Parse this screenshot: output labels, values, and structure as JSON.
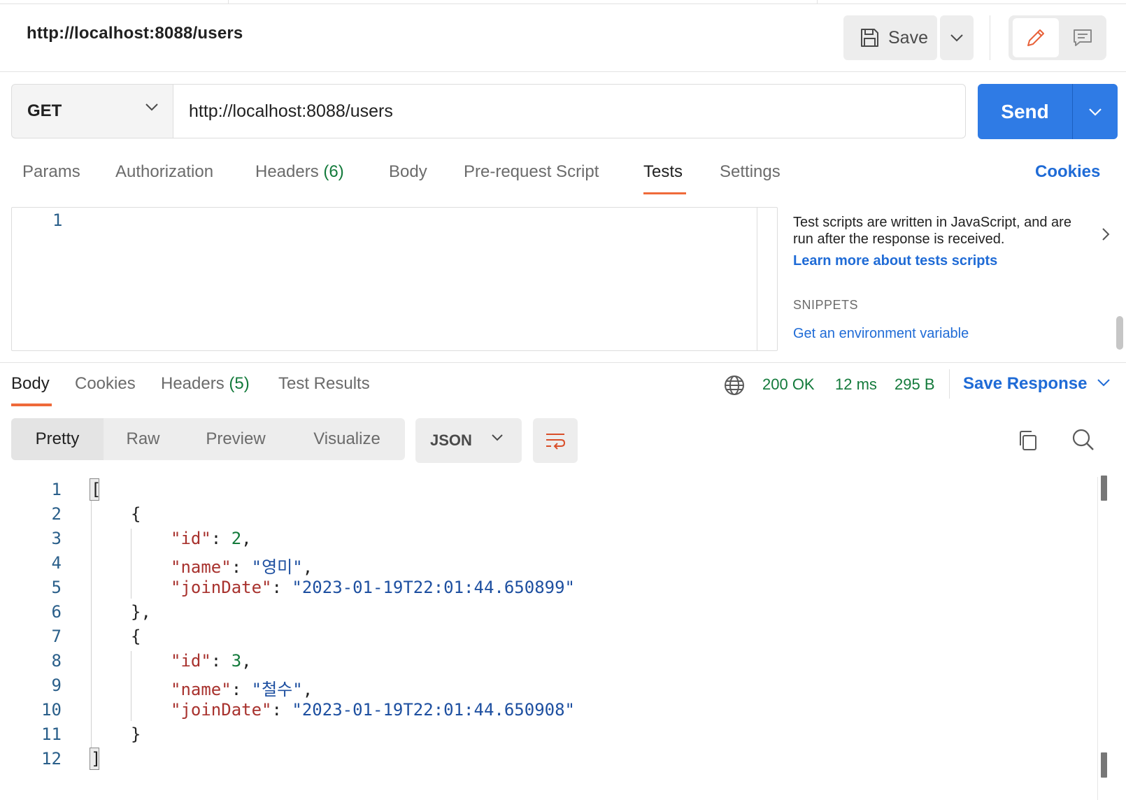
{
  "header": {
    "request_title": "http://localhost:8088/users",
    "save_label": "Save",
    "save_icon": "floppy-disk-icon",
    "edit_icon": "pencil-icon",
    "comment_icon": "comment-icon"
  },
  "request": {
    "method": "GET",
    "url": "http://localhost:8088/users",
    "send_label": "Send"
  },
  "request_tabs": {
    "params": "Params",
    "authorization": "Authorization",
    "headers": "Headers",
    "headers_count": "(6)",
    "body": "Body",
    "prerequest": "Pre-request Script",
    "tests": "Tests",
    "settings": "Settings",
    "active": "Tests",
    "cookies_link": "Cookies"
  },
  "tests_editor": {
    "line_numbers": [
      "1"
    ]
  },
  "side_panel": {
    "help_text": "Test scripts are written in JavaScript, and are run after the response is received.",
    "learn_more": "Learn more about tests scripts",
    "snippets_header": "SNIPPETS",
    "snippet_item": "Get an environment variable"
  },
  "response_tabs": {
    "body": "Body",
    "cookies": "Cookies",
    "headers": "Headers",
    "headers_count": "(5)",
    "test_results": "Test Results",
    "active": "Body"
  },
  "response_status": {
    "status": "200 OK",
    "time": "12 ms",
    "size": "295 B",
    "save_response": "Save Response",
    "status_color": "#137a3b"
  },
  "view_toolbar": {
    "modes": [
      "Pretty",
      "Raw",
      "Preview",
      "Visualize"
    ],
    "active_mode": "Pretty",
    "format": "JSON"
  },
  "response_body": {
    "line_numbers": [
      "1",
      "2",
      "3",
      "4",
      "5",
      "6",
      "7",
      "8",
      "9",
      "10",
      "11",
      "12"
    ],
    "records": [
      {
        "id": 2,
        "name": "영미",
        "joinDate": "2023-01-19T22:01:44.650899"
      },
      {
        "id": 3,
        "name": "철수",
        "joinDate": "2023-01-19T22:01:44.650908"
      }
    ],
    "keys": {
      "id": "\"id\"",
      "name": "\"name\"",
      "joinDate": "\"joinDate\""
    }
  },
  "colors": {
    "accent": "#ef6a3a",
    "primary": "#2f7be5",
    "link": "#1f6bd6",
    "json_key": "#a8322e",
    "json_string": "#1d4fa0",
    "json_number": "#137a3b"
  }
}
